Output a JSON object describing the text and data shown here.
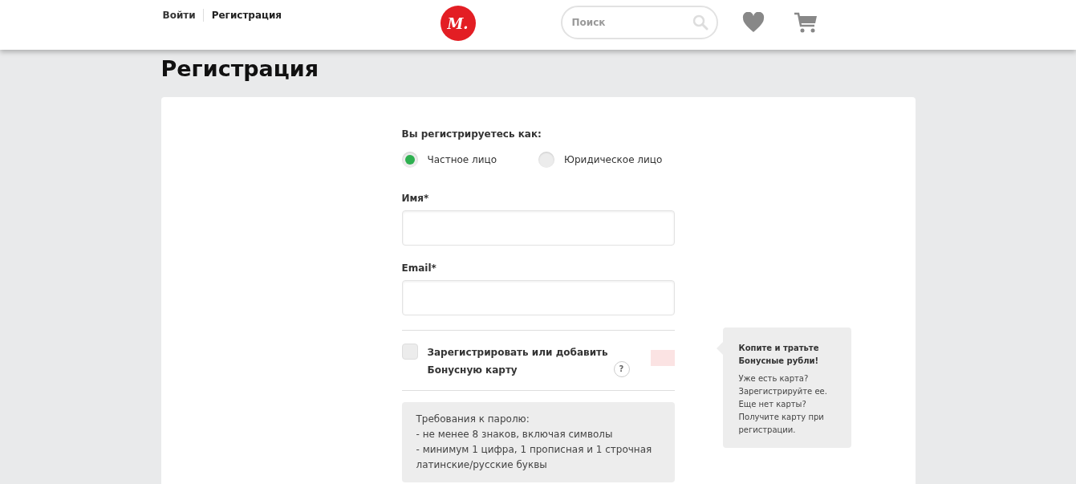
{
  "header": {
    "links": [
      {
        "label": "Войти",
        "selected": false
      },
      {
        "label": "Регистрация",
        "selected": true
      }
    ],
    "logo": {
      "text": "М."
    },
    "search": {
      "placeholder": "Поиск"
    }
  },
  "page_title": "Регистрация",
  "form": {
    "account_type": {
      "label": "Вы регистрируетесь как:",
      "options": [
        {
          "label": "Частное лицо",
          "selected": true
        },
        {
          "label": "Юридическое лицо",
          "selected": false
        }
      ]
    },
    "fields": [
      {
        "label": "Имя*"
      },
      {
        "label": "Email*"
      }
    ],
    "bonus_card": {
      "label": "Зарегистрировать или добавить Бонусную карту",
      "help": "?",
      "checked": false
    },
    "password_requirements": [
      "Требования к паролю:",
      "- не менее 8 знаков, включая символы",
      "- минимум 1 цифра, 1 прописная и 1 строчная латинские/русские буквы"
    ]
  },
  "tooltip": {
    "title": "Копите и тратьте Бонусные рубли!",
    "text": "Уже есть карта? Зарегистрируйте ее. Еще нет карты? Получите карту при регистрации."
  }
}
